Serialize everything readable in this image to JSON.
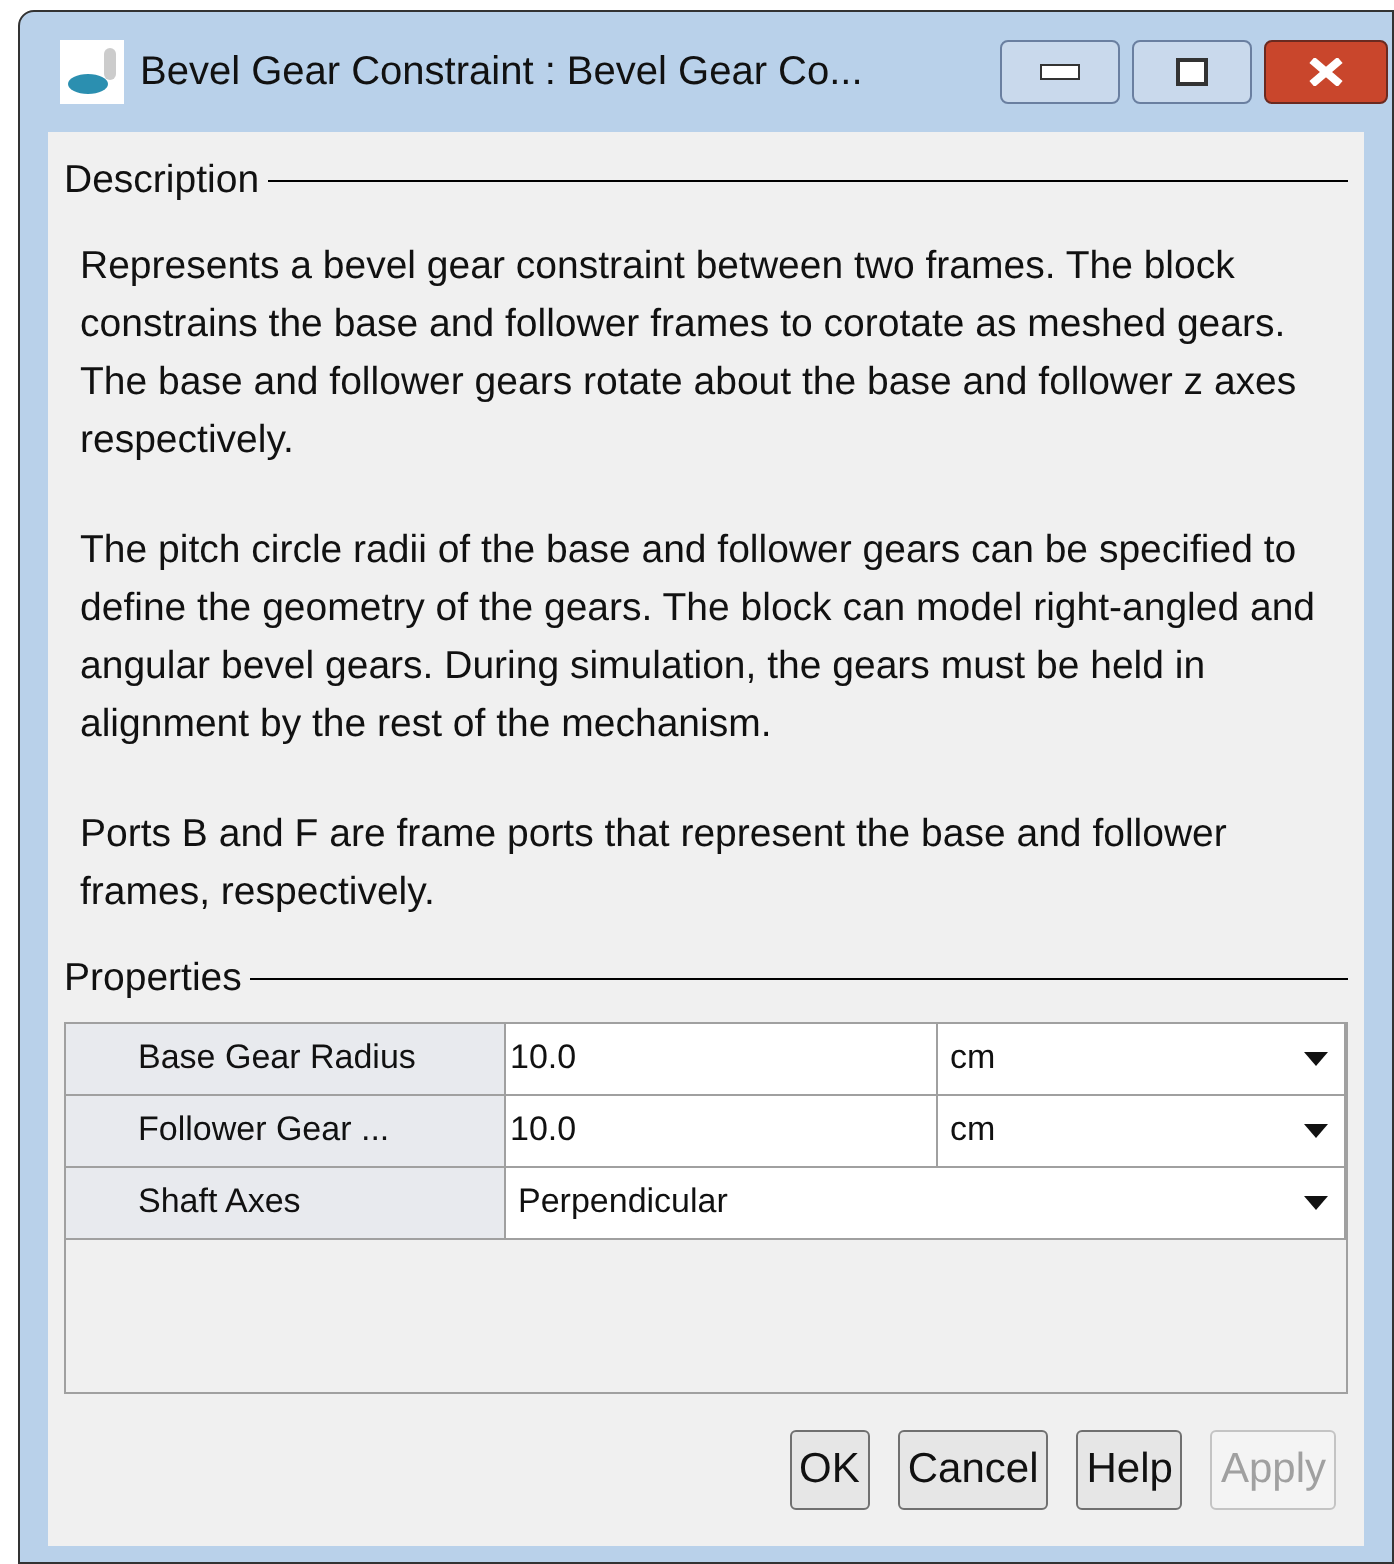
{
  "window": {
    "title": "Bevel Gear Constraint : Bevel Gear Co..."
  },
  "description": {
    "heading": "Description",
    "paragraphs": [
      "Represents a bevel gear constraint between two frames. The block constrains the base and follower frames to corotate as meshed gears. The base and follower gears rotate about the base and follower z axes respectively.",
      "The pitch circle radii of the base and follower gears can be specified to define the geometry of the gears. The block can model right-angled and angular bevel gears. During simulation, the gears must be held in alignment by the rest of the mechanism.",
      "Ports B and F are frame ports that represent the base and follower frames, respectively."
    ]
  },
  "properties": {
    "heading": "Properties",
    "rows": [
      {
        "kind": "value-unit",
        "label": "Base Gear Radius",
        "value": "10.0",
        "unit": "cm"
      },
      {
        "kind": "value-unit",
        "label": "Follower Gear ...",
        "value": "10.0",
        "unit": "cm"
      },
      {
        "kind": "choice",
        "label": "Shaft Axes",
        "value": "Perpendicular"
      }
    ]
  },
  "buttons": [
    {
      "label": "OK",
      "disabled": false
    },
    {
      "label": "Cancel",
      "disabled": false
    },
    {
      "label": "Help",
      "disabled": false
    },
    {
      "label": "Apply",
      "disabled": true
    }
  ]
}
